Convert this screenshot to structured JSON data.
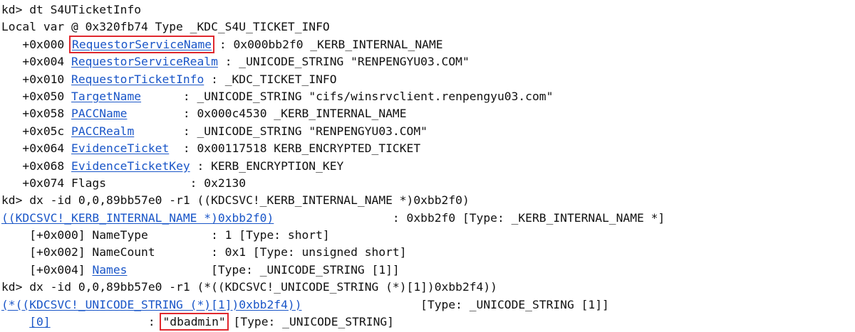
{
  "highlight_color": "#e0282e",
  "link_color": "#1a56c8",
  "lines": [
    {
      "segments": [
        {
          "text": "kd> dt S4UTicketInfo"
        }
      ]
    },
    {
      "segments": [
        {
          "text": "Local var @ 0x320fb74 Type _KDC_S4U_TICKET_INFO"
        }
      ]
    },
    {
      "segments": [
        {
          "text": "   +0x000 "
        },
        {
          "text": "RequestorServiceName",
          "link": true,
          "highlight": true
        },
        {
          "text": " : 0x000bb2f0 _KERB_INTERNAL_NAME"
        }
      ]
    },
    {
      "segments": [
        {
          "text": "   +0x004 "
        },
        {
          "text": "RequestorServiceRealm",
          "link": true
        },
        {
          "text": " : _UNICODE_STRING \"RENPENGYU03.COM\""
        }
      ]
    },
    {
      "segments": [
        {
          "text": "   +0x010 "
        },
        {
          "text": "RequestorTicketInfo",
          "link": true
        },
        {
          "text": " : _KDC_TICKET_INFO"
        }
      ]
    },
    {
      "segments": [
        {
          "text": "   +0x050 "
        },
        {
          "text": "TargetName",
          "link": true
        },
        {
          "text": "      : _UNICODE_STRING \"cifs/winsrvclient.renpengyu03.com\""
        }
      ]
    },
    {
      "segments": [
        {
          "text": "   +0x058 "
        },
        {
          "text": "PACCName",
          "link": true
        },
        {
          "text": "        : 0x000c4530 _KERB_INTERNAL_NAME"
        }
      ]
    },
    {
      "segments": [
        {
          "text": "   +0x05c "
        },
        {
          "text": "PACCRealm",
          "link": true
        },
        {
          "text": "       : _UNICODE_STRING \"RENPENGYU03.COM\""
        }
      ]
    },
    {
      "segments": [
        {
          "text": "   +0x064 "
        },
        {
          "text": "EvidenceTicket",
          "link": true
        },
        {
          "text": "  : 0x00117518 KERB_ENCRYPTED_TICKET"
        }
      ]
    },
    {
      "segments": [
        {
          "text": "   +0x068 "
        },
        {
          "text": "EvidenceTicketKey",
          "link": true
        },
        {
          "text": " : KERB_ENCRYPTION_KEY"
        }
      ]
    },
    {
      "segments": [
        {
          "text": "   +0x074 Flags            : 0x2130"
        }
      ]
    },
    {
      "segments": [
        {
          "text": "kd> dx -id 0,0,89bb57e0 -r1 ((KDCSVC!_KERB_INTERNAL_NAME *)0xbb2f0)"
        }
      ]
    },
    {
      "segments": [
        {
          "text": "((KDCSVC!_KERB_INTERNAL_NAME *)0xbb2f0)",
          "link": true
        },
        {
          "text": "                 : 0xbb2f0 [Type: _KERB_INTERNAL_NAME *]"
        }
      ]
    },
    {
      "segments": [
        {
          "text": "    [+0x000] NameType         : 1 [Type: short]"
        }
      ]
    },
    {
      "segments": [
        {
          "text": "    [+0x002] NameCount        : 0x1 [Type: unsigned short]"
        }
      ]
    },
    {
      "segments": [
        {
          "text": "    [+0x004] "
        },
        {
          "text": "Names",
          "link": true
        },
        {
          "text": "            [Type: _UNICODE_STRING [1]]"
        }
      ]
    },
    {
      "segments": [
        {
          "text": "kd> dx -id 0,0,89bb57e0 -r1 (*((KDCSVC!_UNICODE_STRING (*)[1])0xbb2f4))"
        }
      ]
    },
    {
      "segments": [
        {
          "text": "(*((KDCSVC!_UNICODE_STRING (*)[1])0xbb2f4))",
          "link": true
        },
        {
          "text": "                 [Type: _UNICODE_STRING [1]]"
        }
      ]
    },
    {
      "segments": [
        {
          "text": "    "
        },
        {
          "text": "[0]",
          "link": true
        },
        {
          "text": "              : "
        },
        {
          "text": "\"dbadmin\"",
          "highlight": true
        },
        {
          "text": " [Type: _UNICODE_STRING]"
        }
      ]
    }
  ]
}
